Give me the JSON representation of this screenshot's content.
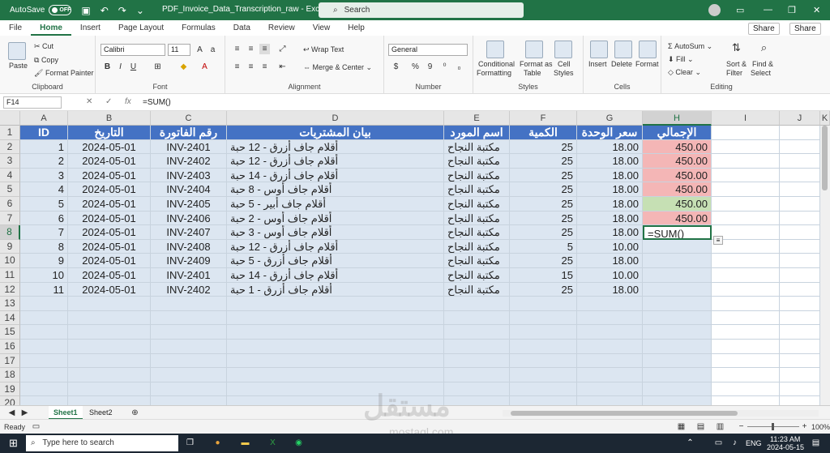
{
  "titlebar": {
    "autosave": "AutoSave",
    "toggle": "OFF",
    "filename": "PDF_Invoice_Data_Transcription_raw  -  Excel",
    "search": "Search"
  },
  "menu": [
    "File",
    "Home",
    "Insert",
    "Page Layout",
    "Formulas",
    "Data",
    "Review",
    "View",
    "Help"
  ],
  "share": [
    "Share",
    "Share"
  ],
  "ribbon": {
    "clipboard": {
      "label": "Clipboard",
      "paste": "Paste",
      "cut": "Cut",
      "copy": "Copy",
      "format_painter": "Format Painter"
    },
    "font": {
      "label": "Font",
      "name": "Calibri",
      "size": "11"
    },
    "alignment": {
      "label": "Alignment",
      "wrap": "Wrap Text",
      "merge": "Merge & Center"
    },
    "number": {
      "label": "Number",
      "format": "General"
    },
    "styles": {
      "label": "Styles",
      "conditional": "Conditional",
      "formatting": "Formatting",
      "format_as": "Format as",
      "table": "Table",
      "cell": "Cell",
      "styles": "Styles"
    },
    "cells": {
      "label": "Cells",
      "insert": "Insert",
      "delete": "Delete",
      "format": "Format"
    },
    "editing": {
      "label": "Editing",
      "autosum": "AutoSum",
      "fill": "Fill",
      "clear": "Clear",
      "sort": "Sort &",
      "filter": "Filter",
      "find": "Find &",
      "select": "Select"
    }
  },
  "formula_bar": {
    "name_box": "F14",
    "formula": "=SUM()"
  },
  "columns": [
    "A",
    "B",
    "C",
    "D",
    "E",
    "F",
    "G",
    "H",
    "I",
    "J",
    "K"
  ],
  "rows": [
    "1",
    "2",
    "3",
    "4",
    "5",
    "6",
    "7",
    "8",
    "9",
    "10",
    "11",
    "12",
    "13",
    "14",
    "15",
    "16",
    "17",
    "18",
    "19",
    "20"
  ],
  "table_headers": [
    "ID",
    "التاريخ",
    "رقم الفاتورة",
    "بيان المشتريات",
    "اسم المورد",
    "الكمية",
    "سعر الوحدة",
    "الإجمالي"
  ],
  "table_rows": [
    [
      "1",
      "2024-05-01",
      "INV-2401",
      "أقلام جاف أزرق - 12 حبة",
      "مكتبة النجاح",
      "25",
      "18.00",
      "450.00"
    ],
    [
      "2",
      "2024-05-01",
      "INV-2402",
      "أقلام جاف أزرق - 12 حبة",
      "مكتبة النجاح",
      "25",
      "18.00",
      "450.00"
    ],
    [
      "3",
      "2024-05-01",
      "INV-2403",
      "أقلام جاف أزرق - 14 حبة",
      "مكتبة النجاح",
      "25",
      "18.00",
      "450.00"
    ],
    [
      "4",
      "2024-05-01",
      "INV-2404",
      "أقلام جاف أوس - 8 حبة",
      "مكتبة النجاح",
      "25",
      "18.00",
      "450.00"
    ],
    [
      "5",
      "2024-05-01",
      "INV-2405",
      "أقلام جاف أبير - 5 حبة",
      "مكتبة النجاح",
      "25",
      "18.00",
      "450.00"
    ],
    [
      "6",
      "2024-05-01",
      "INV-2406",
      "أقلام جاف أوس - 2 حبة",
      "مكتبة النجاح",
      "25",
      "18.00",
      "450.00"
    ],
    [
      "7",
      "2024-05-01",
      "INV-2407",
      "أقلام جاف أوس - 3 حبة",
      "مكتبة النجاح",
      "25",
      "18.00",
      "=SUM()"
    ],
    [
      "8",
      "2024-05-01",
      "INV-2408",
      "أقلام جاف أزرق - 12 حبة",
      "مكتبة النجاح",
      "5",
      "10.00",
      ""
    ],
    [
      "9",
      "2024-05-01",
      "INV-2409",
      "أقلام جاف أزرق - 5 حبة",
      "مكتبة النجاح",
      "25",
      "18.00",
      ""
    ],
    [
      "10",
      "2024-05-01",
      "INV-2401",
      "أقلام جاف أزرق - 14 حبة",
      "مكتبة النجاح",
      "15",
      "10.00",
      ""
    ],
    [
      "11",
      "2024-05-01",
      "INV-2402",
      "أقلام جاف أزرق - 1 حبة",
      "مكتبة النجاح",
      "25",
      "18.00",
      ""
    ]
  ],
  "total_fills": [
    "#f4b6b6",
    "#f4b6b6",
    "#f4b6b6",
    "#f4b6b6",
    "#c6e0b4",
    "#f4b6b6"
  ],
  "colors": {
    "header_fill": "#4472c4",
    "row_fill": "#dce6f1",
    "excel_green": "#217346"
  },
  "sheets": [
    "Sheet1",
    "Sheet2"
  ],
  "status": {
    "ready": "Ready",
    "zoom": "100%"
  },
  "taskbar": {
    "search": "Type here to search",
    "lang": "ENG",
    "time": "11:23 AM",
    "date": "2024-05-15"
  },
  "watermark": {
    "arabic": "مستقل",
    "latin": "mostaql.com"
  }
}
